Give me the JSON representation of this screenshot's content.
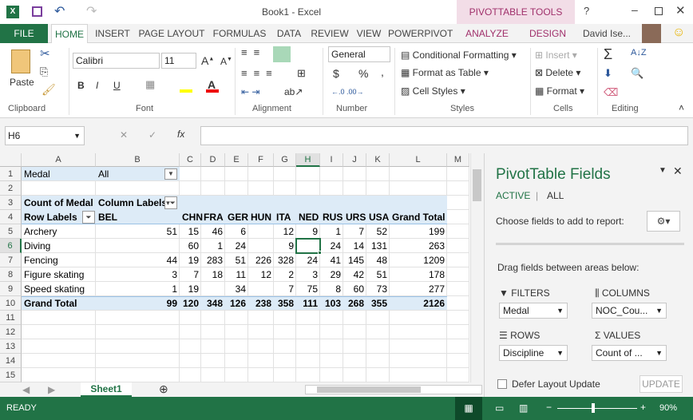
{
  "title": "Book1 - Excel",
  "contextual_tab": "PIVOTTABLE TOOLS",
  "user": "David Ise...",
  "tabs": [
    "FILE",
    "HOME",
    "INSERT",
    "PAGE LAYOUT",
    "FORMULAS",
    "DATA",
    "REVIEW",
    "VIEW",
    "POWERPIVOT",
    "ANALYZE",
    "DESIGN"
  ],
  "active_tab": "HOME",
  "ribbon": {
    "paste": "Paste",
    "font": "Calibri",
    "size": "11",
    "number_format": "General",
    "conditional": "Conditional Formatting",
    "format_table": "Format as Table",
    "cell_styles": "Cell Styles",
    "insert": "Insert",
    "delete": "Delete",
    "format": "Format",
    "groups": [
      "Clipboard",
      "Font",
      "Alignment",
      "Number",
      "Styles",
      "Cells",
      "Editing"
    ]
  },
  "name_box": "H6",
  "formula": "",
  "columns": [
    "A",
    "B",
    "C",
    "D",
    "E",
    "F",
    "G",
    "H",
    "I",
    "J",
    "K",
    "L",
    "M"
  ],
  "rows": [
    "1",
    "2",
    "3",
    "4",
    "5",
    "6",
    "7",
    "8",
    "9",
    "10",
    "11",
    "12",
    "13",
    "14",
    "15"
  ],
  "selected_cell": "H6",
  "pivot": {
    "filter_label": "Medal",
    "filter_value": "All",
    "value_label": "Count of Medal",
    "column_labels": "Column Labels",
    "row_labels": "Row Labels",
    "col_headers": [
      "BEL",
      "CHN",
      "FRA",
      "GER",
      "HUN",
      "ITA",
      "NED",
      "RUS",
      "URS",
      "USA",
      "Grand Total"
    ],
    "rows": [
      {
        "label": "Archery",
        "values": [
          "51",
          "15",
          "46",
          "6",
          "",
          "12",
          "9",
          "1",
          "7",
          "52",
          "199"
        ]
      },
      {
        "label": "Diving",
        "values": [
          "",
          "60",
          "1",
          "24",
          "",
          "9",
          "",
          "24",
          "14",
          "131",
          "263"
        ]
      },
      {
        "label": "Fencing",
        "values": [
          "44",
          "19",
          "283",
          "51",
          "226",
          "328",
          "24",
          "41",
          "145",
          "48",
          "1209"
        ]
      },
      {
        "label": "Figure skating",
        "values": [
          "3",
          "7",
          "18",
          "11",
          "12",
          "2",
          "3",
          "29",
          "42",
          "51",
          "178"
        ]
      },
      {
        "label": "Speed skating",
        "values": [
          "1",
          "19",
          "",
          "34",
          "",
          "7",
          "75",
          "8",
          "60",
          "73",
          "277"
        ]
      }
    ],
    "grand_total_label": "Grand Total",
    "grand_totals": [
      "99",
      "120",
      "348",
      "126",
      "238",
      "358",
      "111",
      "103",
      "268",
      "355",
      "2126"
    ]
  },
  "sheet_tab": "Sheet1",
  "status": "READY",
  "zoom": "90%",
  "fields_panel": {
    "title": "PivotTable Fields",
    "tab_active": "ACTIVE",
    "tab_all": "ALL",
    "choose": "Choose fields to add to report:",
    "drag": "Drag fields between areas below:",
    "filters": "FILTERS",
    "columns": "COLUMNS",
    "rows": "ROWS",
    "values": "VALUES",
    "filters_item": "Medal",
    "columns_item": "NOC_Cou...",
    "rows_item": "Discipline",
    "values_item": "Count of ...",
    "defer": "Defer Layout Update",
    "update": "UPDATE"
  },
  "colors": {
    "accent": "#217346",
    "header_fill": "#ddebf7",
    "contextual": "#a0306b"
  }
}
